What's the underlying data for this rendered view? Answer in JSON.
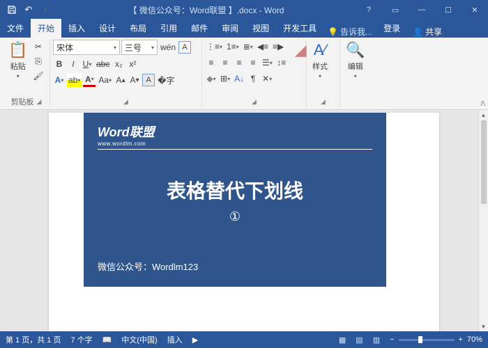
{
  "title": "【 微信公众号：Word联盟 】.docx - Word",
  "tabs": [
    "文件",
    "开始",
    "插入",
    "设计",
    "布局",
    "引用",
    "邮件",
    "审阅",
    "视图",
    "开发工具"
  ],
  "activeTab": 1,
  "tell": "告诉我...",
  "login": "登录",
  "share": "共享",
  "font": {
    "name": "宋体",
    "size": "三号"
  },
  "groups": {
    "clipboard": "剪贴板",
    "paste": "粘贴",
    "styles": "样式",
    "editing": "编辑"
  },
  "slide": {
    "brand": "Word联盟",
    "url": "www.wordlm.com",
    "title": "表格替代下划线",
    "num": "①",
    "foot": "微信公众号：Wordlm123"
  },
  "status": {
    "page": "第 1 页，共 1 页",
    "words": "7 个字",
    "lang": "中文(中国)",
    "mode": "插入",
    "zoom": "70%"
  }
}
